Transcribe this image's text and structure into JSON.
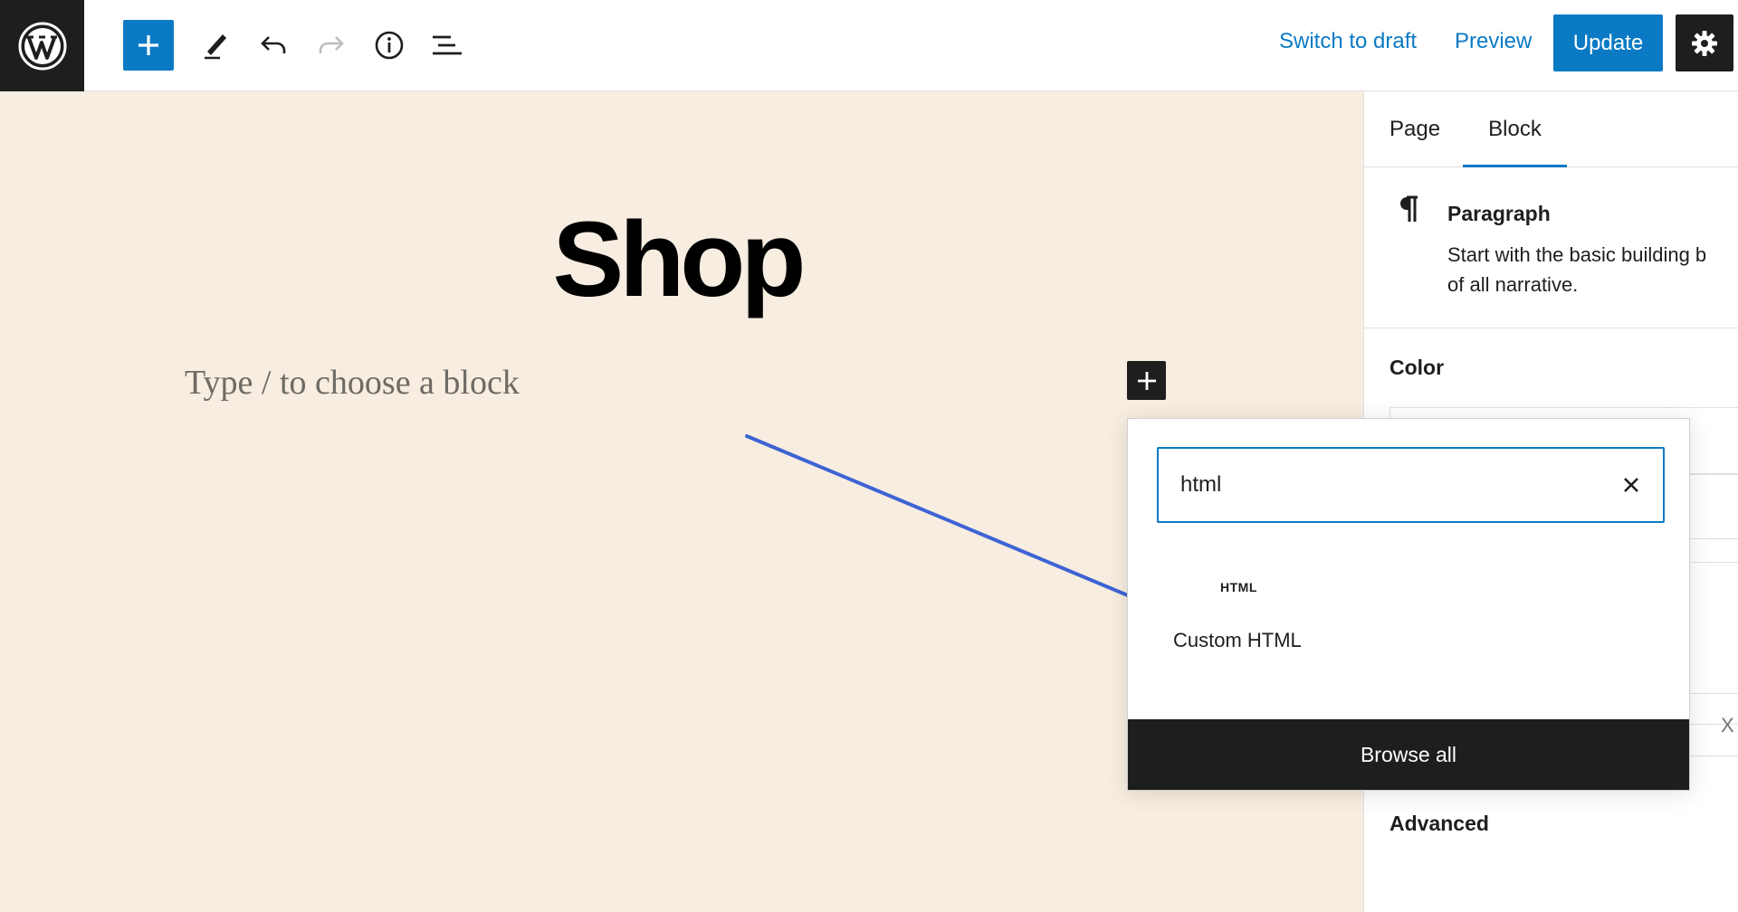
{
  "toolbar": {
    "switch_to_draft": "Switch to draft",
    "preview": "Preview",
    "update": "Update",
    "icons": [
      "wordpress-logo",
      "plus-icon",
      "pencil-icon",
      "undo-icon",
      "redo-icon",
      "info-icon",
      "list-view-icon",
      "gear-icon"
    ]
  },
  "canvas": {
    "title": "Shop",
    "placeholder": "Type / to choose a block"
  },
  "inserter": {
    "search_value": "html",
    "results": [
      {
        "icon_text": "HTML",
        "label": "Custom HTML"
      }
    ],
    "browse_all": "Browse all"
  },
  "sidebar": {
    "tabs": [
      {
        "label": "Page"
      },
      {
        "label": "Block",
        "active": true
      }
    ],
    "block": {
      "name": "Paragraph",
      "description_line1": "Start with the basic building b",
      "description_line2": "of all narrative."
    },
    "panels": {
      "color": "Color",
      "advanced": "Advanced",
      "peek_text": "X"
    }
  },
  "colors": {
    "accent": "#0a7ac4",
    "dark": "#1e1e1e",
    "canvas_bg": "#f7ede0",
    "annotation_arrow": "#3d63d4"
  }
}
